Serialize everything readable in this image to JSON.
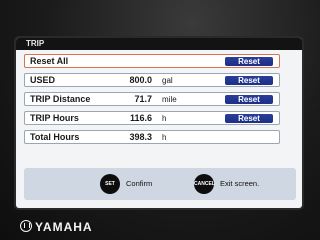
{
  "screen": {
    "title": "TRIP"
  },
  "rows": [
    {
      "label": "Reset All",
      "value": "",
      "unit": "",
      "button": "Reset"
    },
    {
      "label": "USED",
      "value": "800.0",
      "unit": "gal",
      "button": "Reset"
    },
    {
      "label": "TRIP Distance",
      "value": "71.7",
      "unit": "mile",
      "button": "Reset"
    },
    {
      "label": "TRIP Hours",
      "value": "116.6",
      "unit": "h",
      "button": "Reset"
    },
    {
      "label": "Total Hours",
      "value": "398.3",
      "unit": "h",
      "button": ""
    }
  ],
  "footer": {
    "set_button": "SET",
    "set_text": "Confirm",
    "cancel_button": "CANCEL",
    "cancel_text": "Exit screen."
  },
  "brand": {
    "name": "YAMAHA"
  },
  "colors": {
    "reset_button": "#1d2f86",
    "selected_border": "#d9734f",
    "screen_bg": "#f2f4f6"
  }
}
